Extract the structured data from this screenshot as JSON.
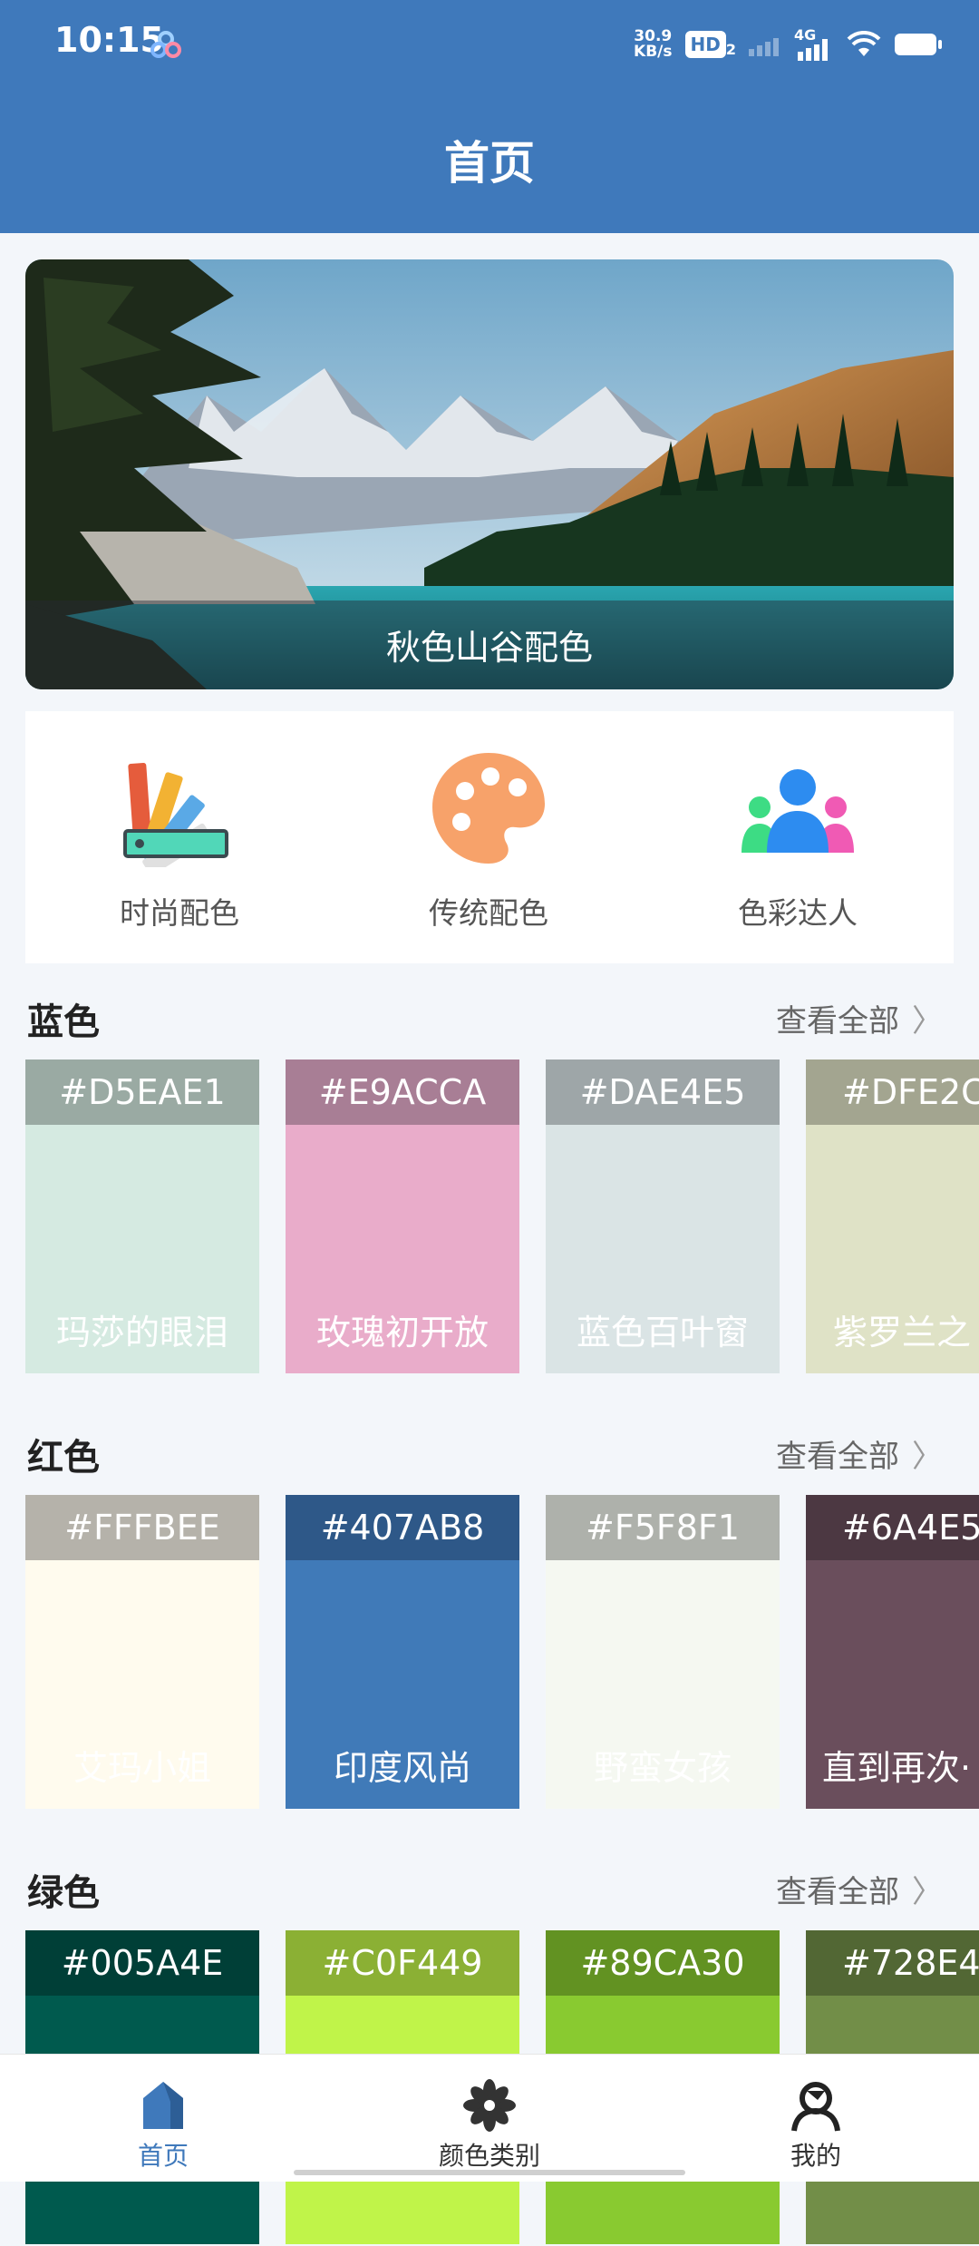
{
  "status_bar": {
    "time": "10:15",
    "net_speed_top": "30.9",
    "net_speed_bottom": "KB/s",
    "hd_label": "HD",
    "hd_sub": "2",
    "net_type": "4G"
  },
  "header": {
    "title": "首页"
  },
  "banner": {
    "title": "秋色山谷配色"
  },
  "categories": [
    {
      "label": "时尚配色",
      "icon": "color-swatch-fan-icon"
    },
    {
      "label": "传统配色",
      "icon": "palette-icon"
    },
    {
      "label": "色彩达人",
      "icon": "people-group-icon"
    }
  ],
  "sections": [
    {
      "title": "蓝色",
      "more": "查看全部",
      "cards": [
        {
          "hex": "#D5EAE1",
          "name": "玛莎的眼泪",
          "color": "#D5EAE1",
          "header_color": "#9AAAA3"
        },
        {
          "hex": "#E9ACCA",
          "name": "玫瑰初开放",
          "color": "#E9ACCA",
          "header_color": "#A87E95"
        },
        {
          "hex": "#DAE4E5",
          "name": "蓝色百叶窗",
          "color": "#DAE4E5",
          "header_color": "#9EA6A8"
        },
        {
          "hex": "#DFE2C",
          "name": "紫罗兰之",
          "color": "#DFE2C6",
          "header_color": "#A3A590"
        }
      ]
    },
    {
      "title": "红色",
      "more": "查看全部",
      "cards": [
        {
          "hex": "#FFFBEE",
          "name": "艾玛小姐",
          "color": "#FFFBEE",
          "header_color": "#B5B2AA"
        },
        {
          "hex": "#407AB8",
          "name": "印度风尚",
          "color": "#407AB8",
          "header_color": "#2E5888"
        },
        {
          "hex": "#F5F8F1",
          "name": "野蛮女孩",
          "color": "#F5F8F1",
          "header_color": "#AEB1AB"
        },
        {
          "hex": "#6A4E5",
          "name": "直到再次·",
          "color": "#6A4E5C",
          "header_color": "#4C3842"
        }
      ]
    },
    {
      "title": "绿色",
      "more": "查看全部",
      "cards": [
        {
          "hex": "#005A4E",
          "name": "",
          "color": "#005A4E",
          "header_color": "#003F37"
        },
        {
          "hex": "#C0F449",
          "name": "",
          "color": "#C0F449",
          "header_color": "#8BB034"
        },
        {
          "hex": "#89CA30",
          "name": "",
          "color": "#89CA30",
          "header_color": "#629222"
        },
        {
          "hex": "#728E4",
          "name": "",
          "color": "#728E48",
          "header_color": "#526734"
        }
      ]
    }
  ],
  "bottom_nav": [
    {
      "label": "首页",
      "icon": "home-icon",
      "active": true
    },
    {
      "label": "颜色类别",
      "icon": "flower-icon",
      "active": false
    },
    {
      "label": "我的",
      "icon": "profile-icon",
      "active": false
    }
  ],
  "colors": {
    "primary": "#3F79BB",
    "background": "#F3F6FA"
  }
}
